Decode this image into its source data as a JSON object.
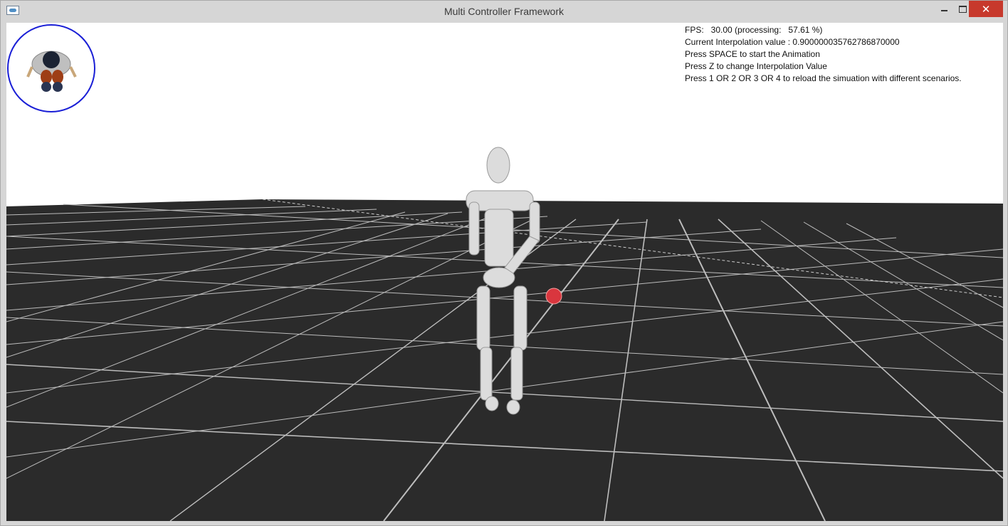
{
  "window": {
    "title": "Multi Controller Framework",
    "close_glyph": "✕"
  },
  "hud": {
    "fps_line": "FPS:   30.00 (processing:   57.61 %)",
    "interp_line": "Current Interpolation value : 0.900000035762786870000",
    "instruction_space": "Press SPACE to start the Animation",
    "instruction_z": "Press Z to change Interpolation Value",
    "instruction_scenarios": "Press 1 OR 2 OR 3 OR 4 to reload the simuation with different scenarios."
  },
  "scene": {
    "sky_color": "#ffffff",
    "ground_color": "#2b2b2b",
    "grid_color": "#bdbdbd",
    "ball_color": "#d9363e",
    "minimap_ring_color": "#1a1fd6",
    "icons": [
      "app-icon",
      "minimize-icon",
      "maximize-icon",
      "close-icon"
    ]
  }
}
